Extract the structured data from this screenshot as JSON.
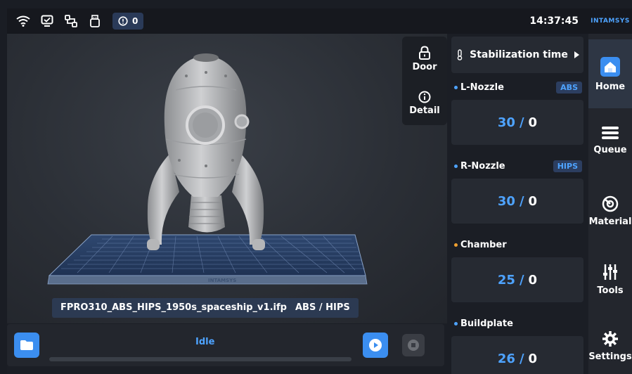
{
  "status_bar": {
    "icons": [
      "wifi-icon",
      "monitor-check-icon",
      "network-icon",
      "usb-icon"
    ],
    "alert_count": "0",
    "time": "14:37:45"
  },
  "brand": "INTAMSYS",
  "side_buttons": {
    "door": "Door",
    "detail": "Detail"
  },
  "viewport": {
    "plate_logo": "INTAMSYS"
  },
  "file": {
    "name": "FPRO310_ABS_HIPS_1950s_spaceship_v1.ifp",
    "materials": "ABS / HIPS"
  },
  "job": {
    "status": "Idle",
    "progress": 0
  },
  "stabilization": {
    "label": "Stabilization time"
  },
  "temps": [
    {
      "name": "L-Nozzle",
      "material": "ABS",
      "current": "30",
      "target": "0",
      "dot": "#4ea3ff"
    },
    {
      "name": "R-Nozzle",
      "material": "HIPS",
      "current": "30",
      "target": "0",
      "dot": "#4ea3ff"
    },
    {
      "name": "Chamber",
      "material": "",
      "current": "25",
      "target": "0",
      "dot": "#f0a030"
    },
    {
      "name": "Buildplate",
      "material": "",
      "current": "26",
      "target": "0",
      "dot": "#4ea3ff"
    }
  ],
  "nav": {
    "home": "Home",
    "queue": "Queue",
    "material": "Material",
    "tools": "Tools",
    "settings": "Settings"
  },
  "colors": {
    "accent": "#3b8ef0",
    "text_accent": "#4ea3ff",
    "chamber_dot": "#f0a030"
  }
}
